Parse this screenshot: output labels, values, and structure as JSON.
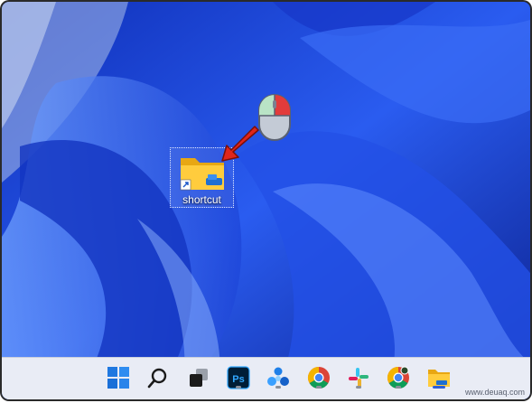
{
  "desktop": {
    "icon": {
      "label": "shortcut",
      "icon": "folder-shortcut-icon"
    }
  },
  "annotations": {
    "arrow": "red-arrow-icon",
    "mouse": "mouse-right-click-icon"
  },
  "watermark": "www.deuaq.com",
  "taskbar": {
    "items": [
      {
        "name": "start",
        "icon": "windows-logo-icon"
      },
      {
        "name": "search",
        "icon": "search-icon"
      },
      {
        "name": "task-view",
        "icon": "task-view-icon"
      },
      {
        "name": "photoshop",
        "icon": "photoshop-icon",
        "text": "Ps",
        "running": true
      },
      {
        "name": "app-blue",
        "icon": "app-icon",
        "running": true
      },
      {
        "name": "chrome-1",
        "icon": "chrome-icon",
        "running": true
      },
      {
        "name": "slack",
        "icon": "slack-icon",
        "running": true
      },
      {
        "name": "chrome-2",
        "icon": "chrome-icon",
        "running": true
      },
      {
        "name": "file-explorer",
        "icon": "folder-icon",
        "running": true,
        "active": true
      }
    ]
  },
  "colors": {
    "accent": "#2d5fd8",
    "wallpaper": "#1a3fd0",
    "arrow": "#e0261b"
  }
}
